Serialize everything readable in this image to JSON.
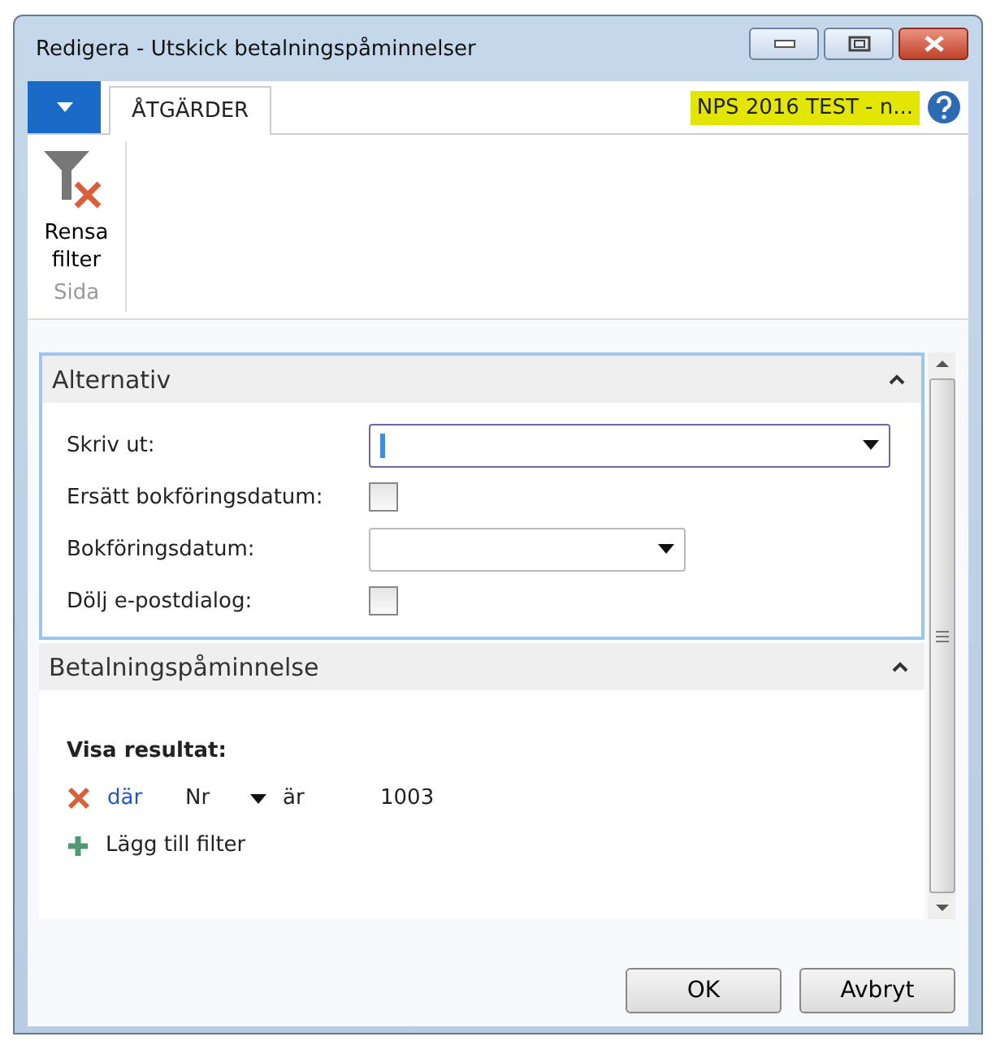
{
  "window": {
    "title": "Redigera - Utskick betalningspåminnelser"
  },
  "tabs": [
    {
      "label": "ÅTGÄRDER",
      "selected": true
    }
  ],
  "company": "NPS 2016 TEST - n...",
  "ribbon": {
    "actions": [
      {
        "label": "Rensa filter"
      }
    ],
    "group": "Sida"
  },
  "sections": [
    {
      "title": "Alternativ",
      "expanded": true,
      "focused": true,
      "fields": [
        {
          "label": "Skriv ut:",
          "kind": "dropdown",
          "wide": true,
          "focused": true
        },
        {
          "label": "Ersätt bokföringsdatum:",
          "kind": "checkbox",
          "checked": false
        },
        {
          "label": "Bokföringsdatum:",
          "kind": "dropdown",
          "wide": false,
          "focused": false
        },
        {
          "label": "Dölj e-postdialog:",
          "kind": "checkbox",
          "checked": false
        }
      ]
    },
    {
      "title": "Betalningspåminnelse",
      "expanded": true,
      "focused": false
    }
  ],
  "filter": {
    "heading": "Visa resultat:",
    "rows": [
      {
        "connector": "där",
        "field": "Nr",
        "operator": "är",
        "value": "1003"
      }
    ],
    "add": "Lägg till filter"
  },
  "buttons": [
    "OK",
    "Avbryt"
  ]
}
